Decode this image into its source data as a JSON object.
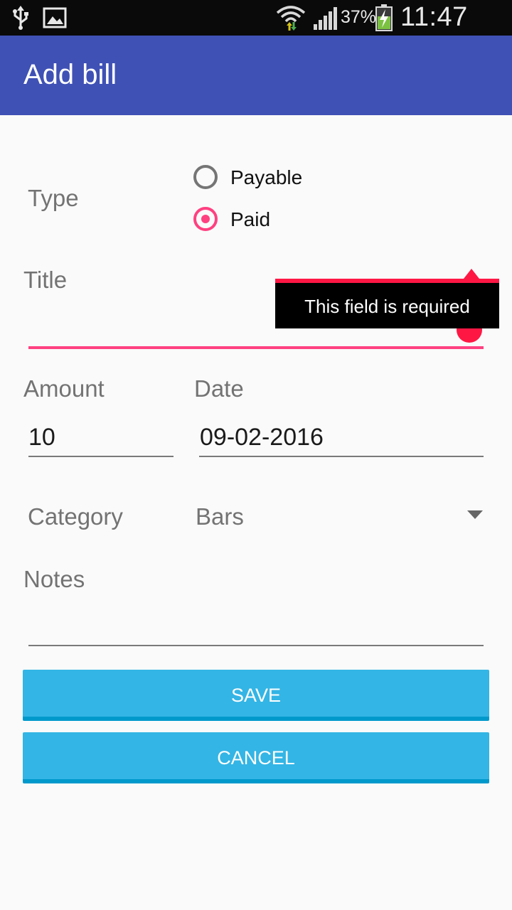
{
  "status_bar": {
    "battery_percent": "37%",
    "time": "11:47 AM",
    "icons": [
      "usb-icon",
      "image-notification-icon",
      "wifi-icon",
      "signal-icon",
      "battery-charging-icon"
    ]
  },
  "app_bar": {
    "title": "Add bill"
  },
  "form": {
    "type": {
      "label": "Type",
      "options": [
        {
          "label": "Payable",
          "checked": false
        },
        {
          "label": "Paid",
          "checked": true
        }
      ]
    },
    "title": {
      "label": "Title",
      "value": "",
      "error": "This field is required"
    },
    "amount": {
      "label": "Amount",
      "value": "10"
    },
    "date": {
      "label": "Date",
      "value": "09-02-2016"
    },
    "category": {
      "label": "Category",
      "selected": "Bars"
    },
    "notes": {
      "label": "Notes",
      "value": ""
    }
  },
  "buttons": {
    "save": "SAVE",
    "cancel": "CANCEL"
  },
  "colors": {
    "primary": "#3f51b5",
    "accent": "#ff4081",
    "error": "#ff1744",
    "button": "#33b5e5"
  }
}
